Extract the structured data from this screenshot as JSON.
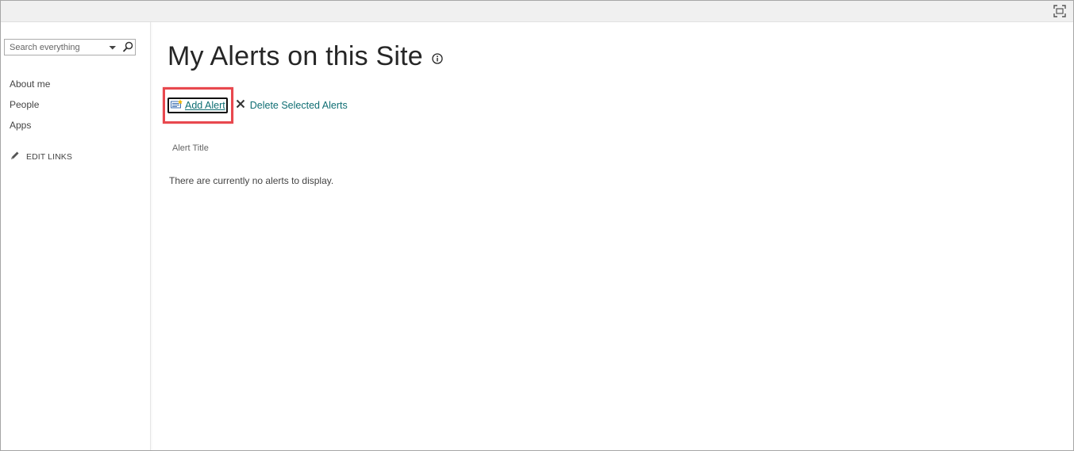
{
  "search": {
    "placeholder": "Search everything"
  },
  "sidebar": {
    "items": [
      {
        "label": "About me"
      },
      {
        "label": "People"
      },
      {
        "label": "Apps"
      }
    ],
    "edit_links_label": "EDIT LINKS"
  },
  "main": {
    "title": "My Alerts on this Site",
    "toolbar": {
      "add_alert_label": "Add Alert",
      "delete_alerts_label": "Delete Selected Alerts"
    },
    "table": {
      "column_header": "Alert Title",
      "empty_message": "There are currently no alerts to display."
    }
  },
  "icons": {
    "focus": "focus-on-content-icon",
    "search_dropdown": "chevron-down-icon",
    "search_go": "search-icon",
    "edit": "pencil-icon",
    "info": "info-icon",
    "add_alert": "add-alert-icon",
    "delete": "close-icon"
  },
  "colors": {
    "link": "#0f6e73",
    "highlight": "#e8484e",
    "title": "#262626"
  }
}
